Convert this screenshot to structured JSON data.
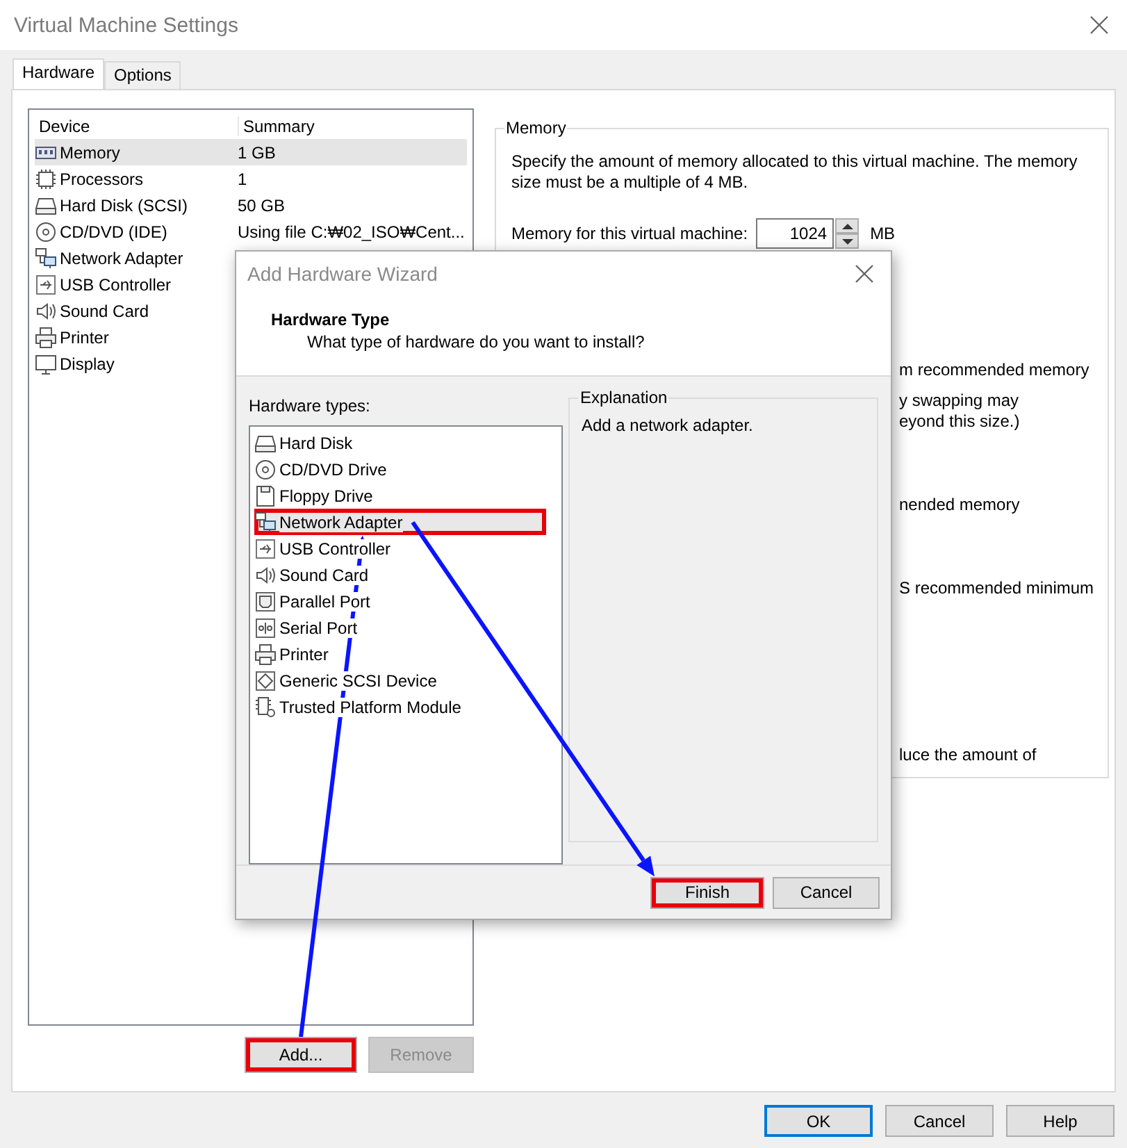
{
  "window": {
    "title": "Virtual Machine Settings"
  },
  "tabs": [
    {
      "label": "Hardware",
      "selected": true
    },
    {
      "label": "Options",
      "selected": false
    }
  ],
  "device_list": {
    "columns": [
      "Device",
      "Summary"
    ],
    "rows": [
      {
        "kind": "memory",
        "device": "Memory",
        "summary": "1 GB",
        "selected": true
      },
      {
        "kind": "cpu",
        "device": "Processors",
        "summary": "1",
        "selected": false
      },
      {
        "kind": "disk",
        "device": "Hard Disk (SCSI)",
        "summary": "50 GB",
        "selected": false
      },
      {
        "kind": "cd",
        "device": "CD/DVD (IDE)",
        "summary": "Using file C:₩02_ISO₩Cent...",
        "selected": false
      },
      {
        "kind": "network",
        "device": "Network Adapter",
        "selected": false
      },
      {
        "kind": "usb",
        "device": "USB Controller",
        "selected": false
      },
      {
        "kind": "sound",
        "device": "Sound Card",
        "selected": false
      },
      {
        "kind": "printer",
        "device": "Printer",
        "selected": false
      },
      {
        "kind": "display",
        "device": "Display",
        "selected": false
      }
    ]
  },
  "device_buttons": [
    {
      "label": "Add...",
      "disabled": false,
      "highlighted": true
    },
    {
      "label": "Remove",
      "disabled": true,
      "highlighted": false
    }
  ],
  "memory": {
    "title": "Memory",
    "description": "Specify the amount of memory allocated to this virtual machine. The memory size must be a multiple of 4 MB.",
    "field_label": "Memory for this virtual machine:",
    "value": "1024",
    "unit": "MB",
    "covered_lines": [
      "m recommended memory",
      "y swapping may",
      "eyond this size.)",
      "nended memory",
      "S recommended minimum",
      "luce the amount of"
    ]
  },
  "dialog": {
    "title": "Add Hardware Wizard",
    "heading": "Hardware Type",
    "subheading": "What type of hardware do you want to install?",
    "list_label": "Hardware types:",
    "hardware_types": [
      {
        "kind": "disk",
        "label": "Hard Disk",
        "selected": false,
        "highlighted": false
      },
      {
        "kind": "cd",
        "label": "CD/DVD Drive",
        "selected": false,
        "highlighted": false
      },
      {
        "kind": "floppy",
        "label": "Floppy Drive",
        "selected": false,
        "highlighted": false
      },
      {
        "kind": "network",
        "label": "Network Adapter",
        "selected": true,
        "highlighted": true
      },
      {
        "kind": "usb",
        "label": "USB Controller",
        "selected": false,
        "highlighted": false
      },
      {
        "kind": "sound",
        "label": "Sound Card",
        "selected": false,
        "highlighted": false
      },
      {
        "kind": "parallel",
        "label": "Parallel Port",
        "selected": false,
        "highlighted": false
      },
      {
        "kind": "serial",
        "label": "Serial Port",
        "selected": false,
        "highlighted": false
      },
      {
        "kind": "printer",
        "label": "Printer",
        "selected": false,
        "highlighted": false
      },
      {
        "kind": "scsi",
        "label": "Generic SCSI Device",
        "selected": false,
        "highlighted": false
      },
      {
        "kind": "tpm",
        "label": "Trusted Platform Module",
        "selected": false,
        "highlighted": false
      }
    ],
    "explanation_title": "Explanation",
    "explanation": "Add a network adapter.",
    "buttons": [
      {
        "label": "Finish",
        "highlighted": true
      },
      {
        "label": "Cancel",
        "highlighted": false
      }
    ]
  },
  "buttons": [
    {
      "label": "OK",
      "default": true
    },
    {
      "label": "Cancel",
      "default": false
    },
    {
      "label": "Help",
      "default": false
    }
  ]
}
